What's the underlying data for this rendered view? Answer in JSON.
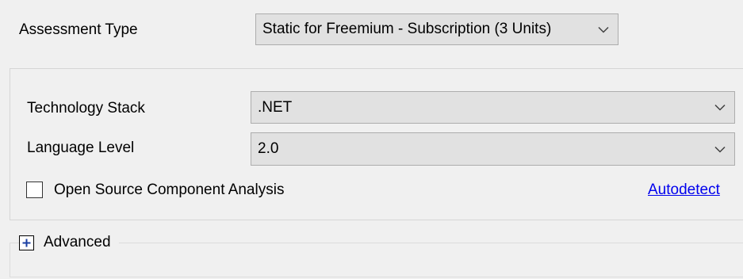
{
  "assessment": {
    "label": "Assessment Type",
    "selected": "Static for Freemium - Subscription (3 Units)"
  },
  "technology_stack": {
    "label": "Technology Stack",
    "selected": ".NET"
  },
  "language_level": {
    "label": "Language Level",
    "selected": "2.0"
  },
  "open_source": {
    "label": "Open Source Component Analysis",
    "checked": false
  },
  "autodetect": {
    "label": "Autodetect"
  },
  "advanced": {
    "label": "Advanced",
    "icon": "plus-square-icon"
  },
  "colors": {
    "background": "#f0f0f0",
    "combo_fill": "#e1e1e1",
    "combo_border": "#adadad",
    "link": "#0000ee"
  },
  "icons": {
    "dropdown": "chevron-down-icon",
    "expander": "plus-square-icon"
  }
}
